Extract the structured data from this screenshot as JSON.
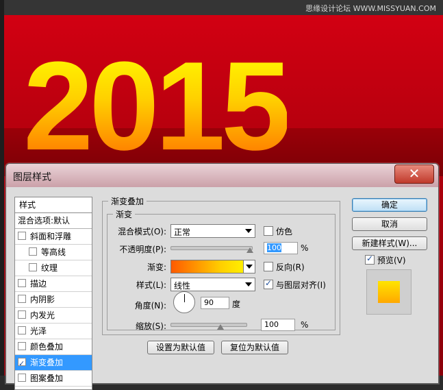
{
  "watermark": "思缘设计论坛 WWW.MISSYUAN.COM",
  "canvas": {
    "text": "2015"
  },
  "dialog": {
    "title": "图层样式",
    "close": "✕",
    "styles_header": "样式",
    "blend_options": "混合选项:默认",
    "items": [
      {
        "label": "斜面和浮雕",
        "checked": false
      },
      {
        "label": "等高线",
        "checked": false
      },
      {
        "label": "纹理",
        "checked": false
      },
      {
        "label": "描边",
        "checked": false
      },
      {
        "label": "内阴影",
        "checked": false
      },
      {
        "label": "内发光",
        "checked": false
      },
      {
        "label": "光泽",
        "checked": false
      },
      {
        "label": "颜色叠加",
        "checked": false
      },
      {
        "label": "渐变叠加",
        "checked": true
      },
      {
        "label": "图案叠加",
        "checked": false
      }
    ],
    "group_title": "渐变叠加",
    "subgroup_title": "渐变",
    "blend_mode_label": "混合模式(O):",
    "blend_mode_value": "正常",
    "dither_label": "仿色",
    "opacity_label": "不透明度(P):",
    "opacity_value": "100",
    "gradient_label": "渐变:",
    "reverse_label": "反向(R)",
    "style_label": "样式(L):",
    "style_value": "线性",
    "align_label": "与图层对齐(I)",
    "angle_label": "角度(N):",
    "angle_value": "90",
    "angle_unit": "度",
    "scale_label": "缩放(S):",
    "scale_value": "100",
    "percent": "%",
    "set_default": "设置为默认值",
    "reset_default": "复位为默认值",
    "ok": "确定",
    "cancel": "取消",
    "new_style": "新建样式(W)...",
    "preview_label": "预览(V)",
    "opacity_percent": 1.0,
    "scale_percent": 1.0,
    "colors": {
      "gradient_start": "#ff5a00",
      "gradient_end": "#ffff00",
      "selection": "#3399ff"
    }
  }
}
